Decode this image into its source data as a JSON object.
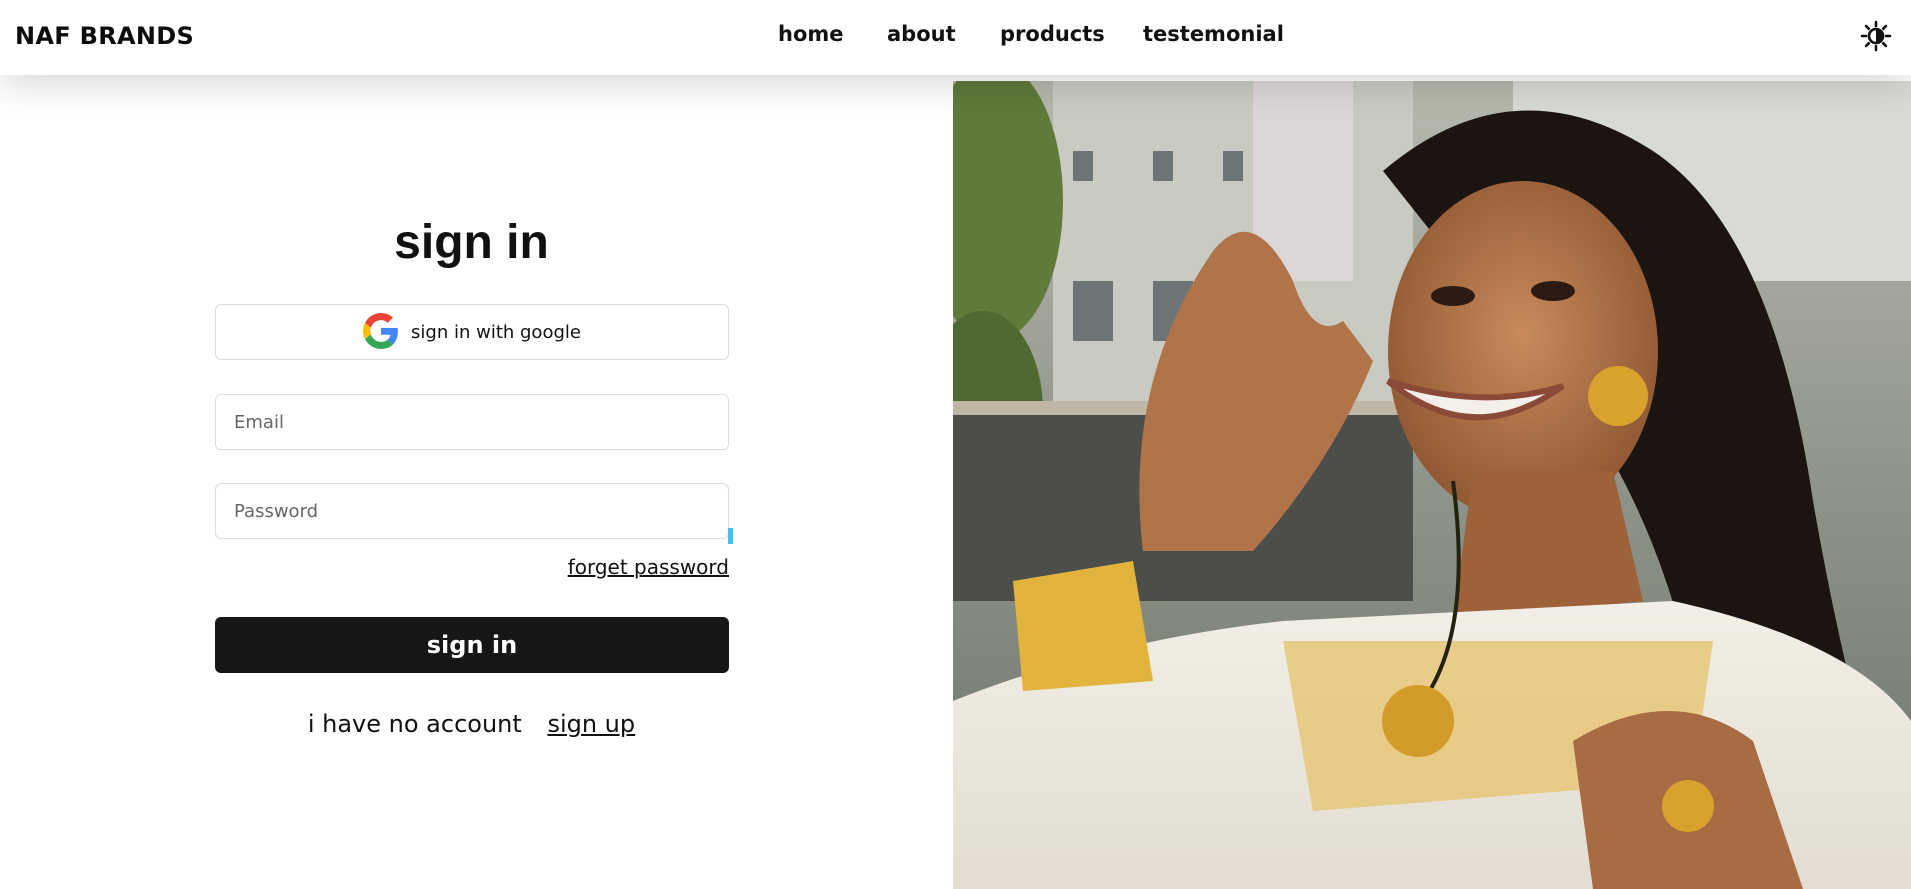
{
  "header": {
    "brand": "NAF BRANDS",
    "nav": [
      {
        "label": "home"
      },
      {
        "label": "about"
      },
      {
        "label": "products"
      },
      {
        "label": "testemonial"
      }
    ],
    "theme_icon": "sun-icon"
  },
  "signin": {
    "title": "sign in",
    "google_label": "sign in with google",
    "google_icon": "google-logo-icon",
    "email_placeholder": "Email",
    "password_placeholder": "Password",
    "forget_label": "forget password",
    "submit_label": "sign in",
    "no_account_text": "i have no account",
    "signup_label": "sign up"
  },
  "hero_image": {
    "description_icon": "photo"
  },
  "colors": {
    "button_dark": "#161616",
    "accent_indicator": "#45c0ec"
  }
}
